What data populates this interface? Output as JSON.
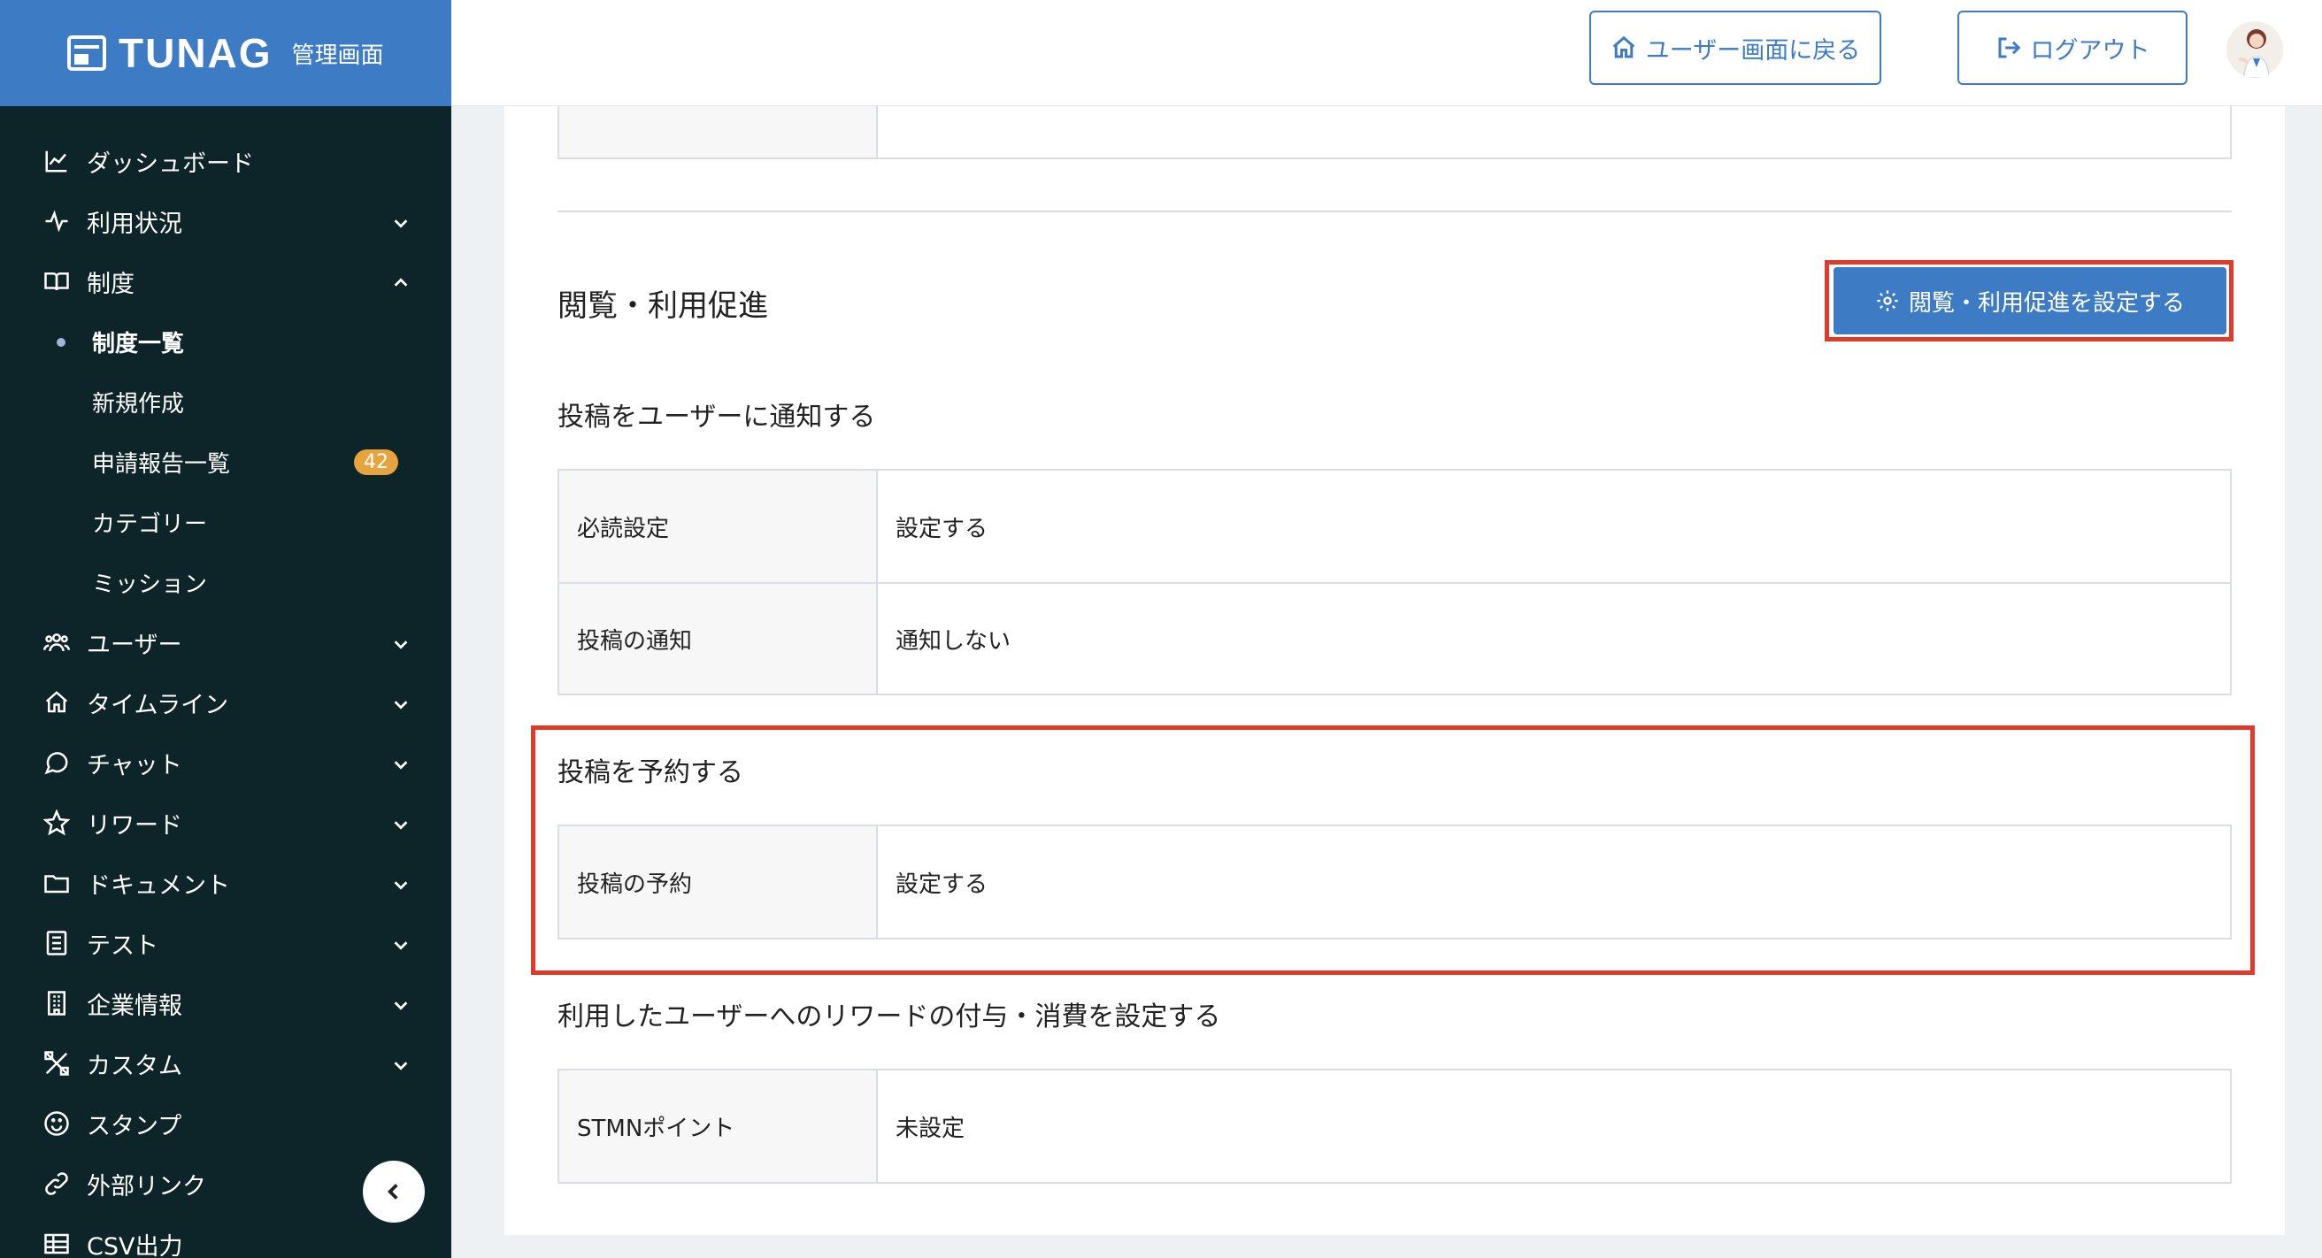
{
  "app": {
    "brand": "TUNAG",
    "subtitle": "管理画面"
  },
  "sidebar": {
    "items": [
      {
        "label": "ダッシュボード",
        "icon": "chart-line-icon"
      },
      {
        "label": "利用状況",
        "icon": "pulse-icon"
      },
      {
        "label": "制度",
        "icon": "book-icon"
      },
      {
        "label": "ユーザー",
        "icon": "users-icon"
      },
      {
        "label": "タイムライン",
        "icon": "home-icon"
      },
      {
        "label": "チャット",
        "icon": "chat-bubble-icon"
      },
      {
        "label": "リワード",
        "icon": "star-icon"
      },
      {
        "label": "ドキュメント",
        "icon": "folder-icon"
      },
      {
        "label": "テスト",
        "icon": "checklist-icon"
      },
      {
        "label": "企業情報",
        "icon": "building-icon"
      },
      {
        "label": "カスタム",
        "icon": "tools-icon"
      },
      {
        "label": "スタンプ",
        "icon": "smile-icon"
      },
      {
        "label": "外部リンク",
        "icon": "link-icon"
      },
      {
        "label": "CSV出力",
        "icon": "table-icon"
      }
    ],
    "sub_items": [
      {
        "label": "制度一覧"
      },
      {
        "label": "新規作成"
      },
      {
        "label": "申請報告一覧",
        "badge": "42"
      },
      {
        "label": "カテゴリー"
      },
      {
        "label": "ミッション"
      }
    ]
  },
  "header": {
    "back_label": "ユーザー画面に戻る",
    "logout_label": "ログアウト"
  },
  "main": {
    "section_title": "閲覧・利用促進",
    "settings_button": "閲覧・利用促進を設定する",
    "notify": {
      "title": "投稿をユーザーに通知する",
      "rows": [
        {
          "key": "必読設定",
          "value": "設定する"
        },
        {
          "key": "投稿の通知",
          "value": "通知しない"
        }
      ]
    },
    "schedule": {
      "title": "投稿を予約する",
      "rows": [
        {
          "key": "投稿の予約",
          "value": "設定する"
        }
      ]
    },
    "reward": {
      "title": "利用したユーザーへのリワードの付与・消費を設定する",
      "rows": [
        {
          "key": "STMNポイント",
          "value": "未設定"
        }
      ]
    }
  },
  "colors": {
    "brand": "#3d7cc5",
    "sidebar": "#0d2428",
    "highlight": "#e03a2b",
    "badge": "#e7a33d"
  }
}
